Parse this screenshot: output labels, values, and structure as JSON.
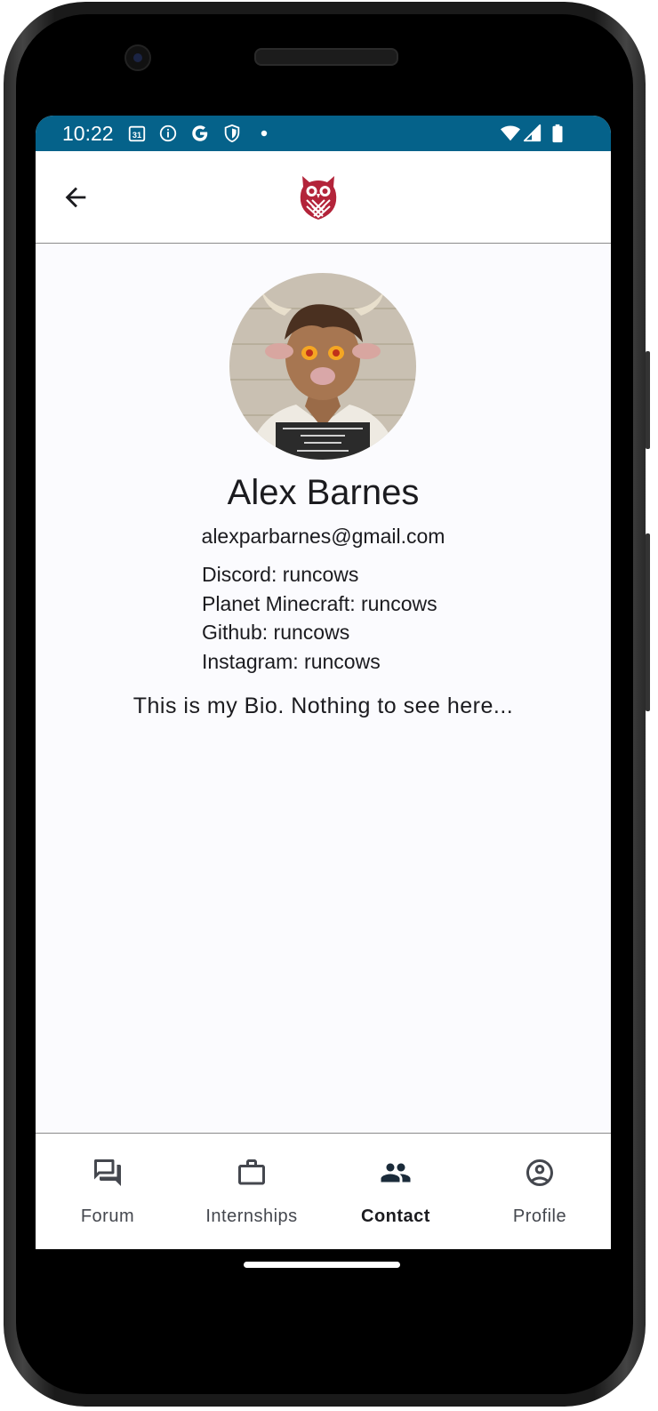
{
  "status_bar": {
    "time": "10:22",
    "calendar_day": "31",
    "background_color": "#05628a"
  },
  "app_bar": {
    "back_icon": "arrow-back-icon",
    "logo": "owl-logo",
    "logo_color": "#b3243a"
  },
  "profile": {
    "name": "Alex Barnes",
    "email": "alexparbarnes@gmail.com",
    "socials": [
      "Discord: runcows",
      "Planet Minecraft: runcows",
      "Github: runcows",
      "Instagram: runcows"
    ],
    "bio": "This is my Bio. Nothing to see here..."
  },
  "bottom_nav": {
    "items": [
      {
        "label": "Forum",
        "icon": "forum-icon",
        "active": false
      },
      {
        "label": "Internships",
        "icon": "briefcase-icon",
        "active": false
      },
      {
        "label": "Contact",
        "icon": "people-icon",
        "active": true
      },
      {
        "label": "Profile",
        "icon": "account-circle-icon",
        "active": false
      }
    ]
  }
}
